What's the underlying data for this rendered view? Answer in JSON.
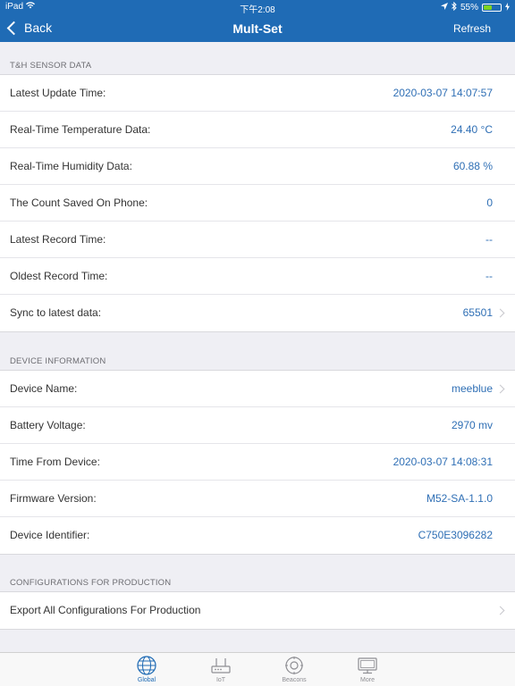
{
  "status_bar": {
    "carrier": "iPad",
    "time": "下午2:08",
    "battery": "55%",
    "battery_level": 0.55
  },
  "nav": {
    "back_label": "Back",
    "title": "Mult-Set",
    "refresh_label": "Refresh"
  },
  "sections": [
    {
      "header": "T&H SENSOR DATA",
      "rows": [
        {
          "label": "Latest Update Time:",
          "value": "2020-03-07 14:07:57"
        },
        {
          "label": "Real-Time Temperature Data:",
          "value": "24.40 °C"
        },
        {
          "label": "Real-Time Humidity Data:",
          "value": "60.88 %"
        },
        {
          "label": "The Count Saved On Phone:",
          "value": "0"
        },
        {
          "label": "Latest Record Time:",
          "value": "--"
        },
        {
          "label": "Oldest Record Time:",
          "value": "--"
        },
        {
          "label": "Sync to latest data:",
          "value": "65501"
        }
      ]
    },
    {
      "header": "DEVICE INFORMATION",
      "rows": [
        {
          "label": "Device Name:",
          "value": "meeblue"
        },
        {
          "label": "Battery Voltage:",
          "value": "2970 mv"
        },
        {
          "label": "Time From Device:",
          "value": "2020-03-07 14:08:31"
        },
        {
          "label": "Firmware Version:",
          "value": "M52-SA-1.1.0"
        },
        {
          "label": "Device Identifier:",
          "value": "C750E3096282"
        }
      ]
    },
    {
      "header": "CONFIGURATIONS FOR PRODUCTION",
      "rows": [
        {
          "label": "Export All Configurations For Production"
        }
      ]
    }
  ],
  "tabs": [
    {
      "label": "Global",
      "icon": "globe-icon",
      "active": true
    },
    {
      "label": "IoT",
      "icon": "router-icon"
    },
    {
      "label": "Beacons",
      "icon": "beacon-icon"
    },
    {
      "label": "More",
      "icon": "monitor-icon"
    }
  ],
  "colors": {
    "nav_bar": "#1f6bb5",
    "value_text": "#2f6fb5",
    "battery_fill": "#7ed321"
  }
}
